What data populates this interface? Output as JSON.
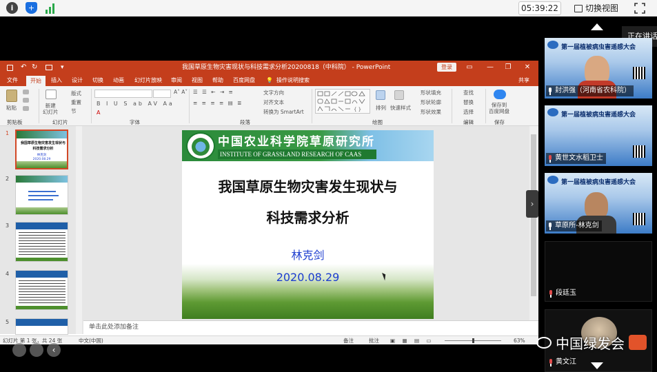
{
  "meeting": {
    "clock": "05:39:22",
    "switch_view": "切换视图",
    "speaking": "正在讲话"
  },
  "ppt": {
    "document_title": "我国草原生物灾害现状与科技需求分析20200818（中科院） - PowerPoint",
    "login": "登录",
    "share": "共享",
    "menu": [
      "文件",
      "开始",
      "插入",
      "设计",
      "切换",
      "动画",
      "幻灯片放映",
      "审阅",
      "视图",
      "帮助",
      "百度网盘"
    ],
    "tell_me": "操作说明搜索",
    "ribbon": {
      "paste": "粘贴",
      "new_slide": "新建\n幻灯片",
      "layout": "版式",
      "reset": "重置",
      "section": "节",
      "text_direction": "文字方向",
      "align_text": "对齐文本",
      "smartart": "转换为 SmartArt",
      "arrange": "排列",
      "quick_styles": "快速样式",
      "shape_fill": "形状填充",
      "shape_outline": "形状轮廓",
      "shape_effects": "形状效果",
      "find": "查找",
      "replace": "替换",
      "select": "选择",
      "save_baidu": "保存到\n百度网盘",
      "groups": [
        "剪贴板",
        "幻灯片",
        "字体",
        "段落",
        "绘图",
        "编辑",
        "保存"
      ]
    },
    "slides": [
      {
        "num": "1",
        "title": "我国草原生物灾害发生现状与科技需求分析",
        "author": "林克剑",
        "date": "2020.08.29"
      },
      {
        "num": "2"
      },
      {
        "num": "3"
      },
      {
        "num": "4"
      },
      {
        "num": "5"
      }
    ],
    "current_slide": {
      "institute_cn": "中国农业科学院草原研究所",
      "institute_en": "INSTITUTE OF GRASSLAND RESEARCH OF CAAS",
      "title_line1": "我国草原生物灾害发生现状与",
      "title_line2": "科技需求分析",
      "author": "林克剑",
      "date": "2020.08.29"
    },
    "notes_placeholder": "单击此处添加备注",
    "status": {
      "slide_count": "幻灯片 第 1 张，共 24 张",
      "language": "中文(中国)",
      "notes": "备注",
      "comments": "批注",
      "zoom": "63%"
    }
  },
  "participants": [
    {
      "name": "封洪强（河南省农科院）",
      "banner": "第一届植被病虫害遥感大会",
      "mic": "on"
    },
    {
      "name": "黄世文水稻卫士",
      "banner": "第一届植被病虫害遥感大会",
      "mic": "muted"
    },
    {
      "name": "草原所-林克剑",
      "banner": "第一届植被病虫害遥感大会",
      "mic": "on"
    },
    {
      "name": "段廷玉",
      "banner": "",
      "mic": "muted"
    },
    {
      "name": "黄文江",
      "banner": "",
      "mic": "muted"
    }
  ],
  "watermark": "中国绿发会",
  "colors": {
    "ppt_accent": "#c43e1c",
    "slide_title": "#111111",
    "slide_author": "#1f3fd0",
    "institute_green": "#1c7a2e"
  }
}
